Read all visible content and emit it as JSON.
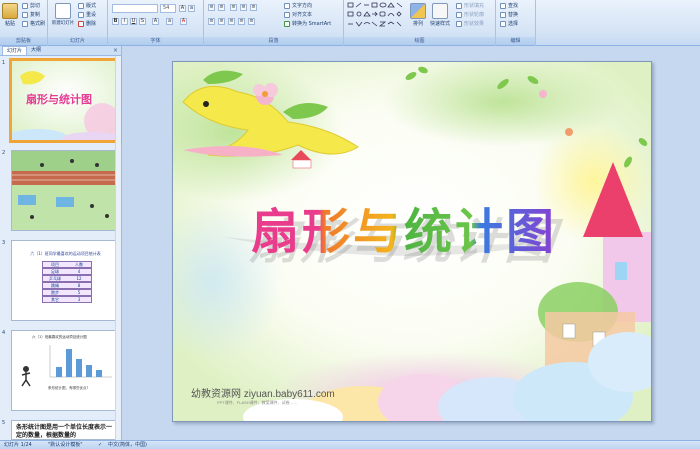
{
  "ribbon": {
    "clipboard": {
      "label": "剪贴板",
      "paste": "粘贴",
      "cut": "剪切",
      "copy": "复制",
      "format_painter": "格式刷"
    },
    "slides": {
      "label": "幻灯片",
      "new_slide": "新建幻灯片",
      "layout": "版式",
      "reset": "重设",
      "delete": "删除"
    },
    "font": {
      "label": "字体",
      "font_size": "54"
    },
    "paragraph": {
      "label": "段落",
      "text_direction": "文字方向",
      "align_text": "对齐文本",
      "smartart": "转换为 SmartArt"
    },
    "drawing": {
      "label": "绘图",
      "arrange": "排列",
      "quick_styles": "快速样式",
      "shape_fill": "形状填充",
      "shape_outline": "形状轮廓",
      "shape_effects": "形状效果"
    },
    "editing": {
      "label": "编辑",
      "find": "查找",
      "replace": "替换",
      "select": "选择"
    }
  },
  "pane": {
    "tab_slides": "幻灯片",
    "tab_outline": "大纲",
    "close_glyph": "×",
    "thumbnails": [
      {
        "num": "1",
        "title": "扇形与统计图"
      },
      {
        "num": "2"
      },
      {
        "num": "3",
        "title": "六（1）班同学最喜欢的运动项目统计表",
        "rows": [
          [
            "项目",
            "人数"
          ],
          [
            "足球",
            "4"
          ],
          [
            "乒乓球",
            "12"
          ],
          [
            "跳绳",
            "8"
          ],
          [
            "跑步",
            "5"
          ],
          [
            "其它",
            "3"
          ]
        ]
      },
      {
        "num": "4",
        "title": "六（1）班最喜欢的运动项目统计图",
        "note": "条形统计图，有哪些优点?"
      },
      {
        "num": "5",
        "text": "条形统计图是用一个单位长度表示一定的数量，根据数量的"
      }
    ]
  },
  "slide": {
    "title": "扇形与统计图",
    "site": "幼教资源网 ziyuan.baby611.com",
    "site_sub": "PPT课件、FLASH课件、教案课件、试卷……"
  },
  "status": {
    "slide_info": "幻灯片 1/24",
    "theme": "\"默认设计模板\"",
    "language": "中文(简体，中国)"
  },
  "colors": {
    "accent": "#f0a636",
    "ribbon": "#d5e4f6"
  }
}
